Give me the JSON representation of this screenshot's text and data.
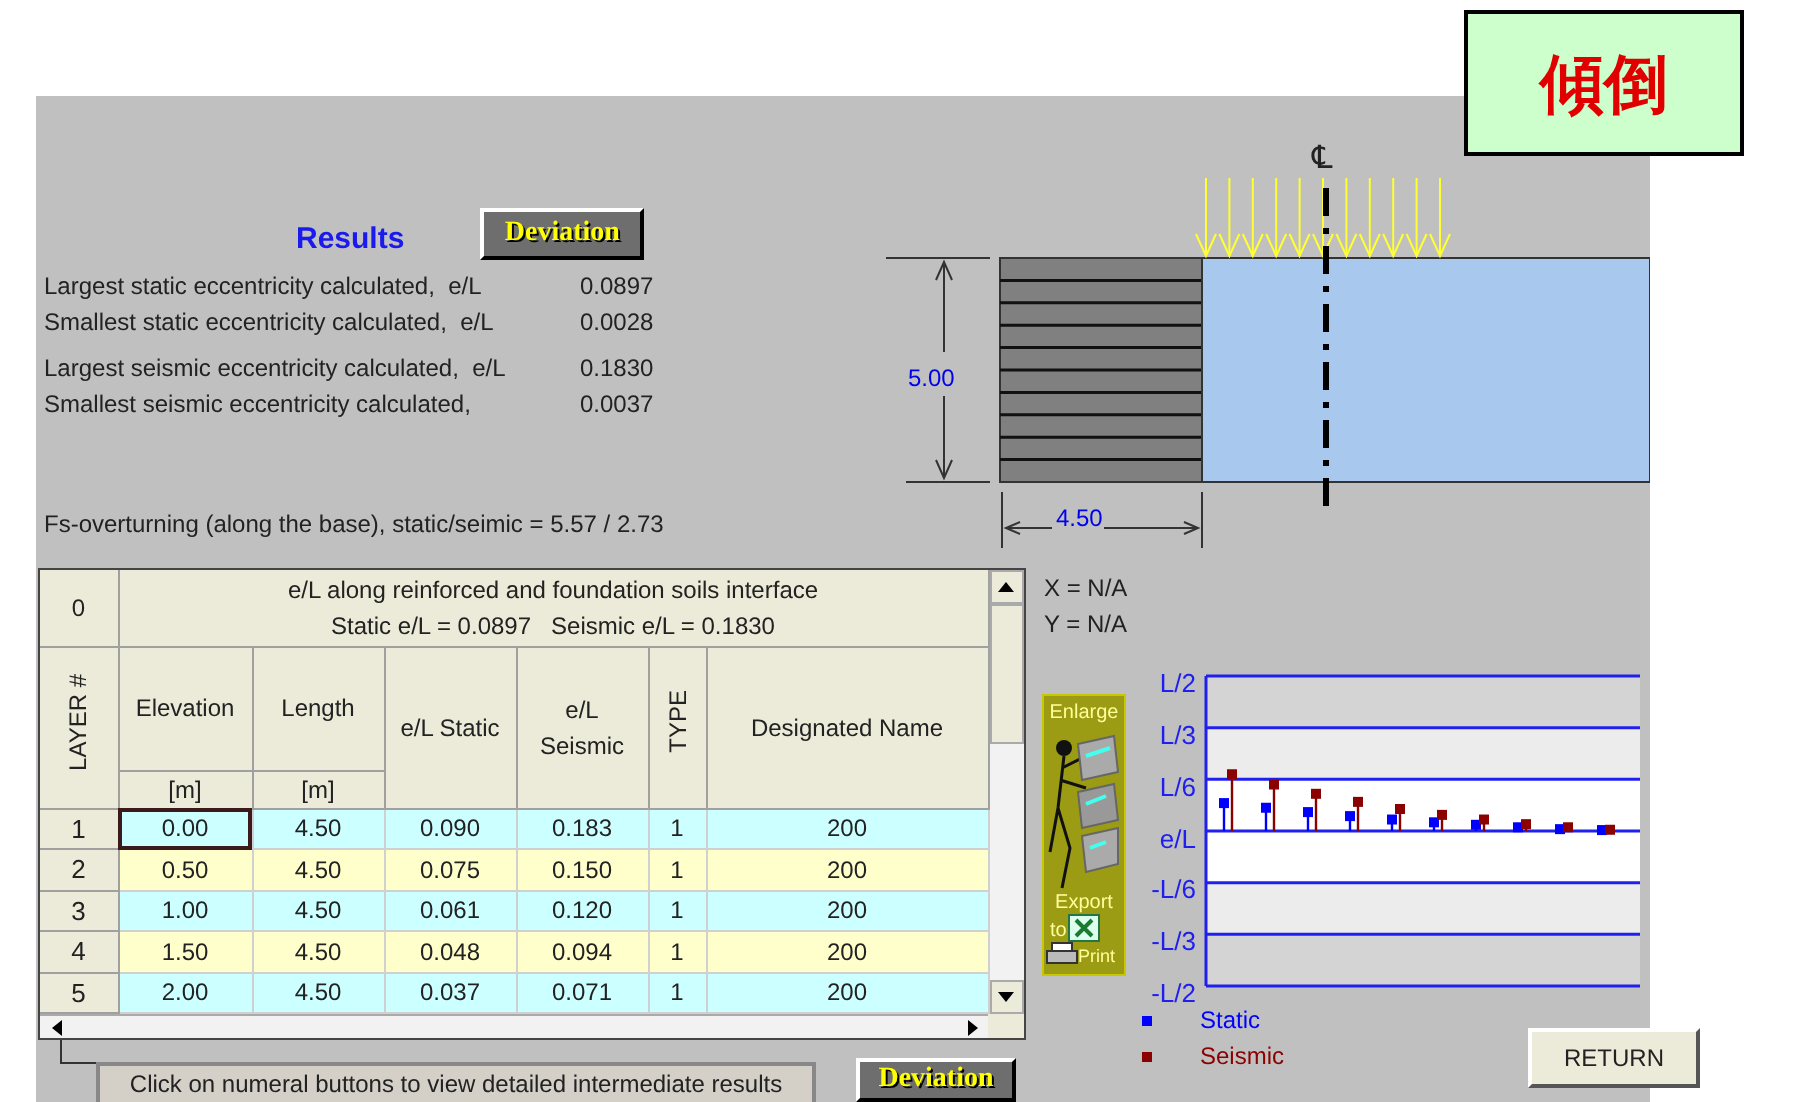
{
  "badge": {
    "text": "傾倒"
  },
  "results": {
    "title": "Results",
    "deviation_button": "Deviation",
    "lines": [
      {
        "label": "Largest static eccentricity calculated,  e/L",
        "value": "0.0897"
      },
      {
        "label": "Smallest static eccentricity calculated,  e/L",
        "value": "0.0028"
      },
      {
        "label": "Largest seismic eccentricity calculated,  e/L",
        "value": "0.1830"
      },
      {
        "label": "Smallest seismic eccentricity calculated,",
        "value": "0.0037"
      }
    ],
    "fs_line": "Fs-overturning (along the base), static/seimic = 5.57 / 2.73"
  },
  "diagram": {
    "centerline": "℄",
    "height_label": "5.00",
    "length_label": "4.50"
  },
  "table": {
    "corner": "0",
    "title": "e/L along reinforced and foundation soils interface",
    "subtitle": "Static e/L = 0.0897   Seismic e/L = 0.1830",
    "layer_header": "LAYER #",
    "columns": [
      {
        "label": "Elevation",
        "unit": "[m]"
      },
      {
        "label": "Length",
        "unit": "[m]"
      },
      {
        "label": "e/L Static"
      },
      {
        "label": "e/L\nSeismic"
      },
      {
        "label": "TYPE",
        "kind": "rotated"
      },
      {
        "label": "Designated Name"
      }
    ],
    "rows": [
      {
        "layer": "1",
        "cells": [
          "0.00",
          "4.50",
          "0.090",
          "0.183",
          "1",
          "200"
        ],
        "selected": true
      },
      {
        "layer": "2",
        "cells": [
          "0.50",
          "4.50",
          "0.075",
          "0.150",
          "1",
          "200"
        ],
        "selected": false
      },
      {
        "layer": "3",
        "cells": [
          "1.00",
          "4.50",
          "0.061",
          "0.120",
          "1",
          "200"
        ],
        "selected": false
      },
      {
        "layer": "4",
        "cells": [
          "1.50",
          "4.50",
          "0.048",
          "0.094",
          "1",
          "200"
        ],
        "selected": false
      },
      {
        "layer": "5",
        "cells": [
          "2.00",
          "4.50",
          "0.037",
          "0.071",
          "1",
          "200"
        ],
        "selected": false
      }
    ]
  },
  "hint": "Click on numeral buttons to view detailed intermediate results",
  "bottom_deviation_button": "Deviation",
  "coords": {
    "x": "X = N/A",
    "y": "Y = N/A"
  },
  "tool_panel": {
    "enlarge": "Enlarge",
    "export": "Export",
    "to": "to",
    "print": "Print"
  },
  "chart": {
    "axis_labels": [
      "L/2",
      "L/3",
      "L/6",
      "e/L",
      "-L/6",
      "-L/3",
      "-L/2"
    ],
    "legend": [
      {
        "name": "Static",
        "color": "#0000ff"
      },
      {
        "name": "Seismic",
        "color": "#8b0000"
      }
    ]
  },
  "return_button": "RETURN"
}
